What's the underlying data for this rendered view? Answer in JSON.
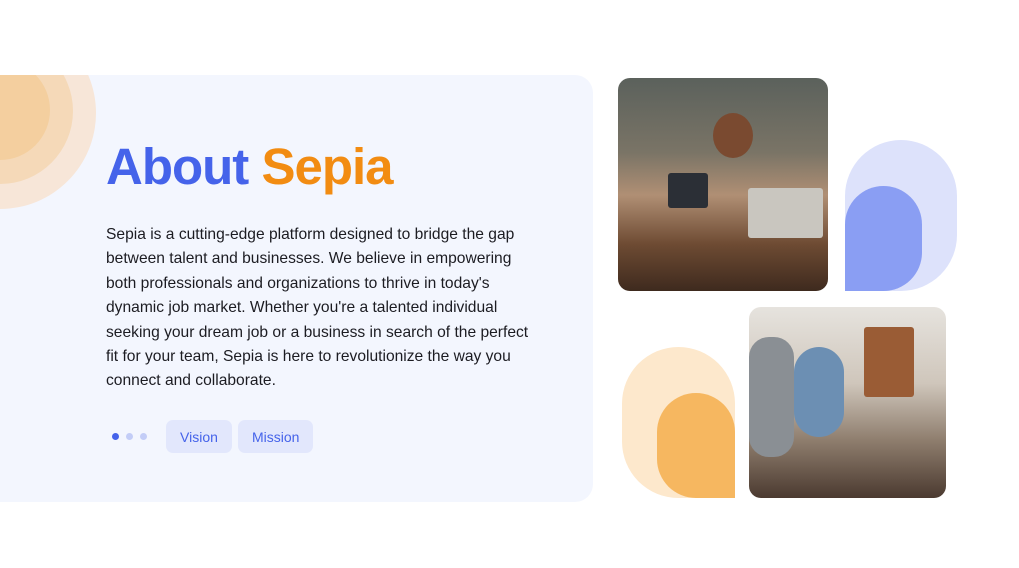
{
  "heading": {
    "part1": "About",
    "part2": "Sepia"
  },
  "description": "Sepia is a cutting-edge platform designed to bridge the gap between talent and businesses. We believe in empowering both professionals and organizations to thrive in today's dynamic job market. Whether you're a talented individual seeking your dream job or a business in search of the perfect fit for your team, Sepia is here to revolutionize the way you connect and collaborate.",
  "carousel": {
    "count": 3,
    "active": 0
  },
  "buttons": {
    "vision": "Vision",
    "mission": "Mission"
  },
  "colors": {
    "blue": "#4563ea",
    "orange": "#f28c12",
    "panel": "#f3f6fe"
  }
}
